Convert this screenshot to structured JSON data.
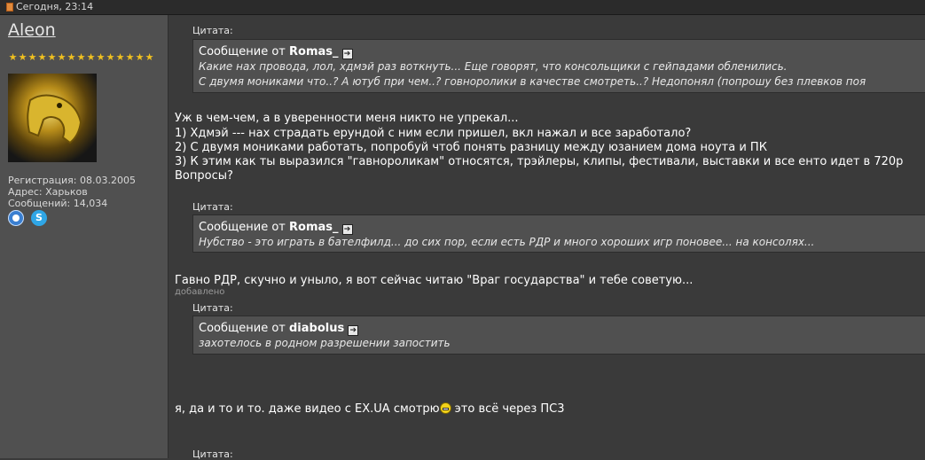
{
  "header": {
    "date": "Сегодня, 23:14"
  },
  "user": {
    "name": "Aleon",
    "star_count": 15,
    "reg": "Регистрация: 08.03.2005",
    "addr": "Адрес: Харьков",
    "posts": "Сообщений: 14,034"
  },
  "quotes": [
    {
      "label": "Цитата:",
      "prefix": "Сообщение от",
      "author": "Romas_",
      "lines": [
        "Какие нах провода, лол, хдмэй раз воткнуть... Еще говорят, что консольщики с гейпадами обленились.",
        "С двумя мониками что..? А ютуб при чем..? говноролики в качестве смотреть..? Недопонял (попрошу без плевков поя"
      ]
    },
    {
      "label": "Цитата:",
      "prefix": "Сообщение от",
      "author": "Romas_",
      "lines": [
        "Нубство - это играть в бателфилд... до сих пор, если есть РДР и много хороших игр поновее... на консолях..."
      ]
    },
    {
      "label": "Цитата:",
      "prefix": "Сообщение от",
      "author": "diabolus",
      "lines": [
        "захотелось в родном разрешении запостить"
      ]
    }
  ],
  "reply1": [
    "Уж в чем-чем, а в уверенности меня никто не упрекал...",
    "1) Хдмэй --- нах страдать ерундой с ним если пришел, вкл нажал и все заработало?",
    "2) С двумя мониками работать, попробуй чтоб понять разницу между юзанием дома ноута и ПК",
    "3) К этим как ты выразился \"гавнороликам\" относятся, трэйлеры, клипы, фестивали, выставки и все енто идет в 720р",
    "Вопросы?"
  ],
  "reply2": "Гавно РДР, скучно и уныло, я вот сейчас читаю \"Враг государства\" и тебе советую...",
  "added_label": "добавлено",
  "reply3_before": "я, да и то и то. даже видео с EX.UA смотрю",
  "reply3_after": "это всё через ПС3",
  "next_quote_label": "Цитата:"
}
